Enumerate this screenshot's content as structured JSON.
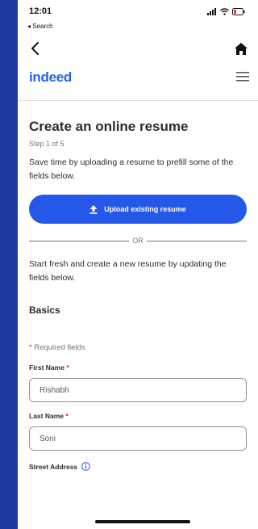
{
  "status_bar": {
    "time": "12:01",
    "back_to_app": "◂ Search"
  },
  "brand": {
    "logo_text": "indeed"
  },
  "form": {
    "title": "Create an online resume",
    "step": "Step 1 of 5",
    "intro": "Save time by uploading a resume to prefill some of the fields below.",
    "upload_label": "Upload existing resume",
    "or_text": "OR",
    "fresh_text": "Start fresh and create a new resume by updating the fields below.",
    "section_title": "Basics",
    "required_star": "*",
    "required_note": "Required fields",
    "first_name_label": "First Name",
    "first_name_value": "Rishabh",
    "last_name_label": "Last Name",
    "last_name_value": "Soni",
    "street_label": "Street Address"
  },
  "colors": {
    "background": "#1f3a9e",
    "accent": "#2557e8",
    "required": "#c41e3a"
  },
  "icons": [
    "back-arrow-icon",
    "home-icon",
    "hamburger-menu-icon",
    "upload-icon",
    "info-icon",
    "signal-icon",
    "wifi-icon",
    "battery-icon"
  ]
}
